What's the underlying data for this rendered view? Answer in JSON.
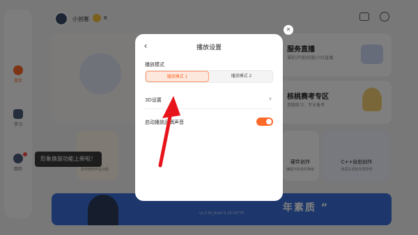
{
  "topbar": {
    "username": "小创客",
    "coin_count": "8"
  },
  "sidebar": {
    "items": [
      {
        "label": "首页"
      },
      {
        "label": "学习"
      },
      {
        "label": "我的"
      }
    ]
  },
  "cards": {
    "live": {
      "title": "服务直播",
      "subtitle": "课前|开营|结营|小灶直播"
    },
    "exam": {
      "title": "核桃赛考专区",
      "subtitle": "真题练习、专业备考"
    },
    "mini1": {
      "subtitle": "如何使用作品功能"
    },
    "hardware": {
      "title": "硬件创作",
      "subtitle": "编程与科技的奥秘"
    },
    "cpp": {
      "title": "C++自由创作",
      "subtitle": "用语言成就无限梦想"
    }
  },
  "banner": {
    "slogan": "年素质 ”",
    "version": "v2.2.90_Build 0.26.34770"
  },
  "tooltip": {
    "text": "形象换装功能上新啦！"
  },
  "modal": {
    "title": "播放设置",
    "back_icon": "‹",
    "play_mode_label": "播放模式",
    "play_modes": [
      "播放模式 1",
      "播放模式 2"
    ],
    "selected_mode_index": 0,
    "row_3d_label": "3D设置",
    "row_3d_chevron": "›",
    "sound_label": "启动播放品牌声音",
    "sound_enabled": true,
    "close_icon": "✕"
  },
  "colors": {
    "accent": "#ff6a2a",
    "annotation_arrow": "#e8141b"
  }
}
